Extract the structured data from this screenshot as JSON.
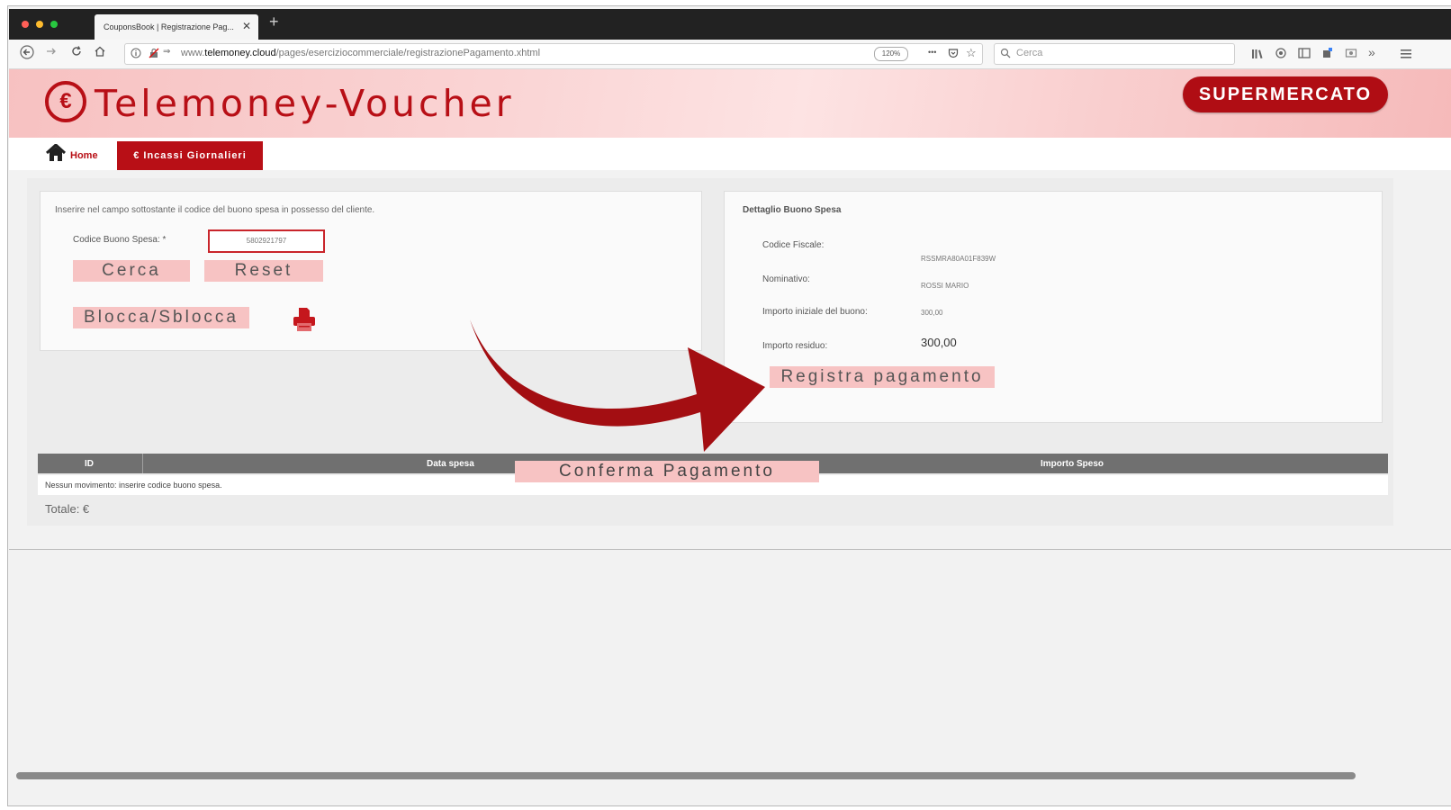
{
  "browser": {
    "tab_title": "CouponsBook | Registrazione Pag...",
    "tab_close": "✕",
    "new_tab": "+",
    "url_prefix": "www.",
    "url_domain": "telemoney.cloud",
    "url_path": "/pages/eserciziocommerciale/registrazionePagamento.xhtml",
    "zoom": "120%",
    "search_placeholder": "Cerca",
    "more_icon": "•••"
  },
  "header": {
    "logo_symbol": "€",
    "title": "Telemoney-Voucher",
    "badge": "SUPERMERCATO"
  },
  "menu": {
    "home": "Home",
    "active": "€ Incassi Giornalieri"
  },
  "search_panel": {
    "instructions": "Inserire nel campo sottostante il codice del buono spesa in possesso del cliente.",
    "code_label": "Codice Buono Spesa:  *",
    "code_value": "5802921797",
    "search_button": "Cerca",
    "reset_button": "Reset",
    "lock_button": "Blocca/Sblocca"
  },
  "detail_panel": {
    "title": "Dettaglio Buono Spesa",
    "fiscal_code_label": "Codice Fiscale:",
    "fiscal_code_value": "RSSMRA80A01F839W",
    "name_label": "Nominativo:",
    "name_value": "ROSSI MARIO",
    "initial_amount_label": "Importo iniziale del buono:",
    "initial_amount_value": "300,00",
    "residual_label": "Importo residuo:",
    "residual_value": "300,00",
    "register_button": "Registra pagamento"
  },
  "table": {
    "columns": [
      "ID",
      "Data spesa",
      "Importo Speso"
    ],
    "empty_message": "Nessun movimento: inserire codice buono spesa.",
    "total": "Totale: €"
  },
  "overlay": {
    "confirm_button": "Conferma Pagamento"
  },
  "colors": {
    "brand_red": "#b80f16",
    "button_pink": "#f7c3c3",
    "table_header": "#707070"
  }
}
